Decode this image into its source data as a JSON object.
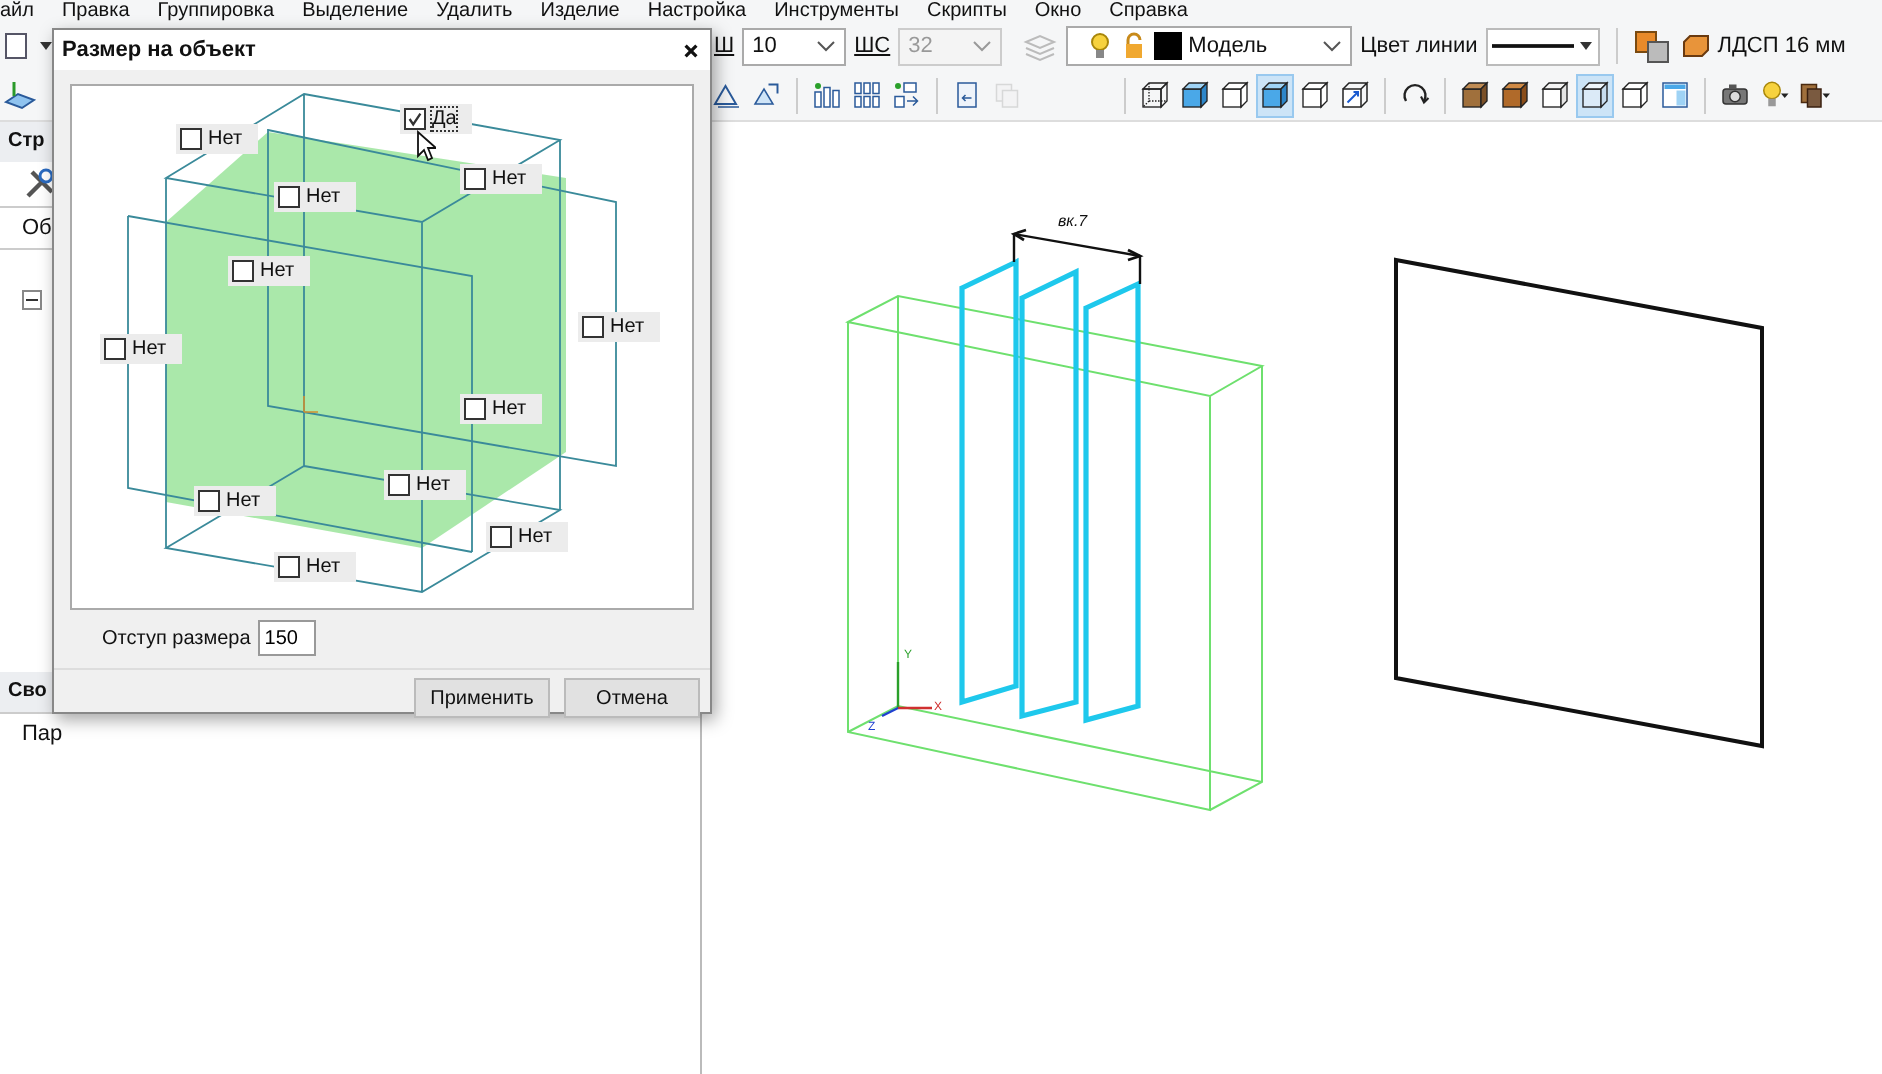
{
  "menu": [
    "айл",
    "Правка",
    "Группировка",
    "Выделение",
    "Удалить",
    "Изделие",
    "Настройка",
    "Инструменты",
    "Скрипты",
    "Окно",
    "Справка"
  ],
  "toolbar_1": {
    "width_label": "Ш",
    "width_value": "10",
    "step_label": "ШС",
    "step_value": "32",
    "step_disabled": true,
    "layer": "Модель",
    "line_color_label": "Цвет линии",
    "material": "ЛДСП 16 мм"
  },
  "toolbar_2": {
    "groups": [
      {
        "buttons": [
          {
            "kind": "sketch",
            "selected": false,
            "disabled": false
          },
          {
            "kind": "sketch-move",
            "selected": false,
            "disabled": false
          }
        ]
      },
      {
        "buttons": [
          {
            "kind": "blocks",
            "selected": false,
            "disabled": false
          },
          {
            "kind": "grid",
            "selected": false,
            "disabled": false
          },
          {
            "kind": "arrange",
            "selected": false,
            "disabled": false
          }
        ]
      },
      {
        "buttons": [
          {
            "kind": "insert",
            "selected": false,
            "disabled": false
          },
          {
            "kind": "copy",
            "selected": false,
            "disabled": true
          }
        ]
      },
      {
        "buttons": [
          {
            "kind": "cube-wire",
            "selected": false,
            "disabled": false
          },
          {
            "kind": "cube-blue",
            "selected": false,
            "disabled": false
          },
          {
            "kind": "cube-outline",
            "selected": false,
            "disabled": false
          },
          {
            "kind": "cube-blue",
            "selected": true,
            "disabled": false
          },
          {
            "kind": "cube-outline",
            "selected": false,
            "disabled": false
          },
          {
            "kind": "cube-arrows",
            "selected": false,
            "disabled": false
          }
        ]
      },
      {
        "buttons": [
          {
            "kind": "rotate",
            "selected": false,
            "disabled": false
          }
        ]
      },
      {
        "buttons": [
          {
            "kind": "cube-wood",
            "selected": false,
            "disabled": false
          },
          {
            "kind": "cube-brown",
            "selected": false,
            "disabled": false
          },
          {
            "kind": "cube-white",
            "selected": false,
            "disabled": false
          },
          {
            "kind": "cube-clear",
            "selected": true,
            "disabled": false
          },
          {
            "kind": "cube-outline",
            "selected": false,
            "disabled": false
          },
          {
            "kind": "panel",
            "selected": false,
            "disabled": false
          }
        ]
      },
      {
        "buttons": [
          {
            "kind": "camera",
            "selected": false,
            "disabled": false
          },
          {
            "kind": "bulb",
            "selected": false,
            "disabled": false
          },
          {
            "kind": "material",
            "selected": false,
            "disabled": false
          }
        ]
      }
    ]
  },
  "left_panel": {
    "structure_header": "Стр",
    "objects_tab": "Об",
    "properties_header": "Сво",
    "parameters_label": "Пар"
  },
  "dialog": {
    "title": "Размер на объект",
    "checkboxes": [
      {
        "label": "Да",
        "checked": true
      },
      {
        "label": "Нет",
        "checked": false
      },
      {
        "label": "Нет",
        "checked": false
      },
      {
        "label": "Нет",
        "checked": false
      },
      {
        "label": "Нет",
        "checked": false
      },
      {
        "label": "Нет",
        "checked": false
      },
      {
        "label": "Нет",
        "checked": false
      },
      {
        "label": "Нет",
        "checked": false
      },
      {
        "label": "Нет",
        "checked": false
      },
      {
        "label": "Нет",
        "checked": false
      },
      {
        "label": "Нет",
        "checked": false
      },
      {
        "label": "Нет",
        "checked": false
      }
    ],
    "offset_label": "Отступ размера",
    "offset_value": "150",
    "buttons": [
      "Применить",
      "Отмена"
    ]
  },
  "viewport": {
    "dimension_text": "вк.7",
    "axis_labels": [
      "Y",
      "Z",
      "X"
    ]
  }
}
